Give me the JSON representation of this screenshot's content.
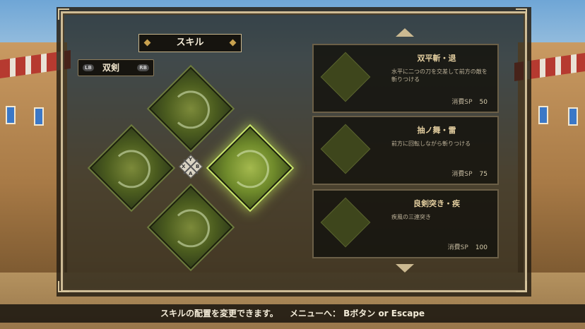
{
  "title": "スキル",
  "weapon": {
    "name": "双剣",
    "prev_button": "LB",
    "next_button": "RB"
  },
  "slots": [
    {
      "key": "Y",
      "position": "top",
      "state": "normal"
    },
    {
      "key": "X",
      "position": "left",
      "state": "normal"
    },
    {
      "key": "B",
      "position": "right",
      "state": "selected"
    },
    {
      "key": "A",
      "position": "bottom",
      "state": "normal"
    }
  ],
  "button_pad": {
    "y": "Y",
    "x": "X",
    "b": "B",
    "a": "A"
  },
  "skills": [
    {
      "name": "双平斬・退",
      "description": "水平に二つの刀を交差して前方の敵を斬りつける",
      "cost_label": "消費SP",
      "cost": "50"
    },
    {
      "name": "抽ノ舞・雷",
      "description": "前方に回転しながら斬りつける",
      "cost_label": "消費SP",
      "cost": "75"
    },
    {
      "name": "良剣突き・疾",
      "description": "疾風の三連突き",
      "cost_label": "消費SP",
      "cost": "100"
    }
  ],
  "footer": {
    "message": "スキルの配置を変更できます。",
    "menu_hint": "メニューへ： Bボタン or Escape"
  }
}
